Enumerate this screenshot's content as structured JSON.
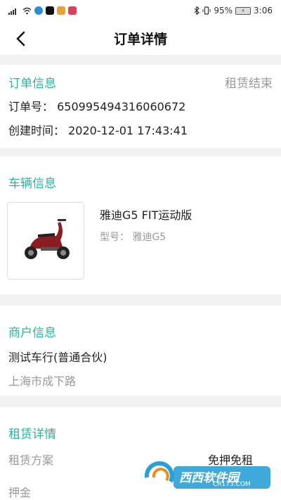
{
  "status": {
    "battery": "95%",
    "time": "3:06"
  },
  "header": {
    "title": "订单详情"
  },
  "order_info": {
    "title": "订单信息",
    "status": "租赁结束",
    "order_no_label": "订单号：",
    "order_no": "650995494316060672",
    "created_label": "创建时间：",
    "created": "2020-12-01 17:43:41"
  },
  "vehicle_info": {
    "title": "车辆信息",
    "name": "雅迪G5 FIT运动版",
    "model_label": "型号：",
    "model": "雅迪G5"
  },
  "merchant_info": {
    "title": "商户信息",
    "name": "测试车行(普通合伙)",
    "address": "上海市成下路"
  },
  "rental_detail": {
    "title": "租赁详情",
    "plan_label": "租赁方案",
    "plan_value": "免押免租",
    "deposit_label": "押金"
  },
  "watermark": {
    "text": "西西软件园",
    "url": "CR173.COM"
  }
}
